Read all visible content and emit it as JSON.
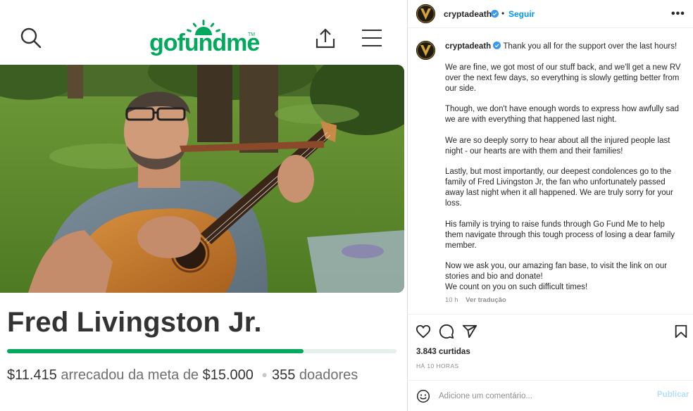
{
  "gofundme": {
    "logo_text": "gofundme",
    "logo_tm": "TM",
    "brand_color": "#02a95c",
    "icons": [
      "search-icon",
      "share-icon",
      "menu-icon"
    ],
    "photo_alt": "Man with glasses playing acoustic guitar outdoors",
    "fundraiser_name": "Fred Livingston Jr.",
    "progress_fraction": 0.761,
    "raised": "$11.415",
    "raised_text": "arrecadou da meta de",
    "goal": "$15.000",
    "donors_count": "355",
    "donors_label": "doadores"
  },
  "instagram": {
    "header": {
      "username": "cryptadeath",
      "separator": "•",
      "follow_label": "Seguir",
      "more_label": "•••"
    },
    "caption": {
      "username": "cryptadeath",
      "first_line": "Thank you all for the support over the last hours!",
      "paragraphs": [
        "We are fine, we got most of our stuff back, and we'll get a new RV over the next few days, so everything is slowly getting better from our side.",
        "Though, we don't have enough words to express how awfully sad we are with everything that happened last night.",
        "We are so deeply sorry to hear about all the injured people last night - our hearts are with them and their families!",
        "Lastly, but most importantly, our deepest condolences go to the family of Fred Livingston Jr, the fan who unfortunately passed away last night when it all happened. We are truly sorry for your loss.",
        "His family is trying to raise funds through Go Fund Me to help them navigate through this tough process of losing a dear family member.",
        "Now we ask you, our amazing fan base, to visit the link on our stories and bio and donate!",
        "We count on you on such difficult times!"
      ]
    },
    "meta": {
      "time": "10 h",
      "translate": "Ver tradução"
    },
    "likes": "3.843 curtidas",
    "time_ago": "HÁ 10 HORAS",
    "comment_placeholder": "Adicione um comentário...",
    "publish_label": "Publicar",
    "accent_color": "#0095f6",
    "action_icons": [
      "heart-icon",
      "comment-icon",
      "send-icon",
      "bookmark-icon"
    ]
  }
}
